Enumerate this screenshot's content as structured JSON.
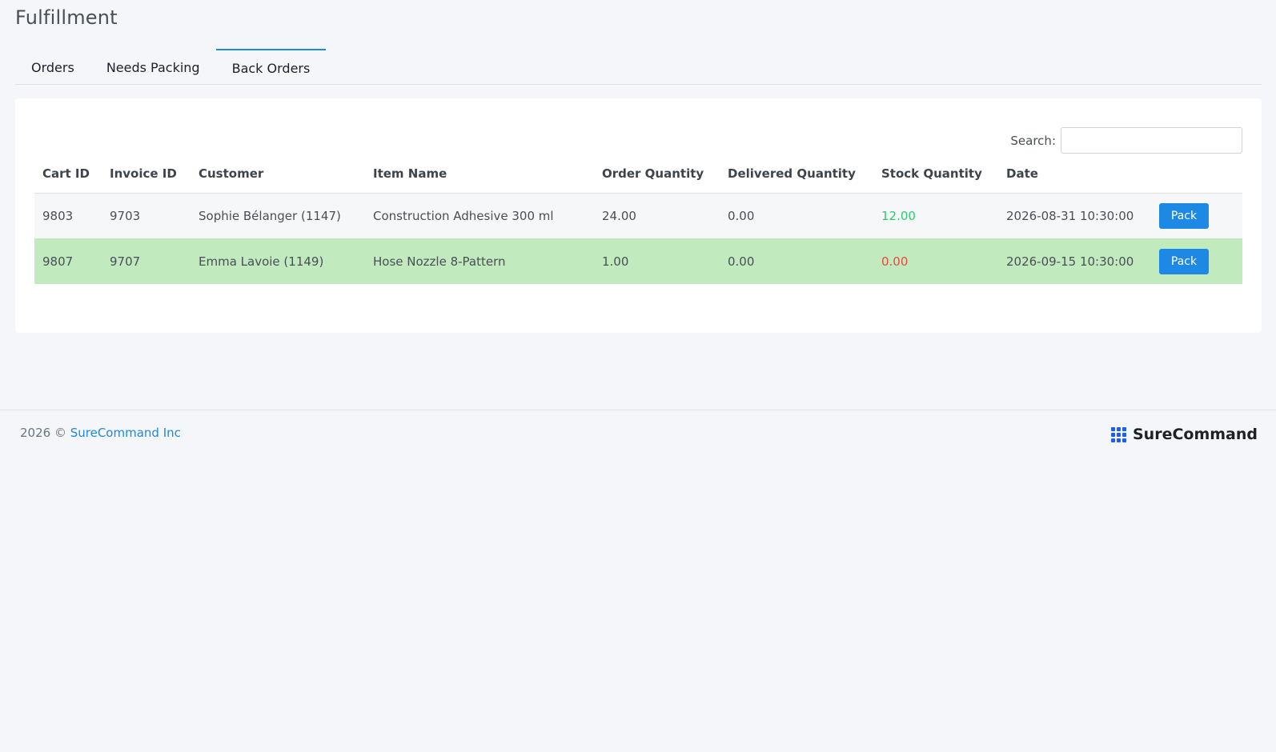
{
  "page": {
    "title": "Fulfillment"
  },
  "tabs": [
    {
      "label": "Orders",
      "active": false
    },
    {
      "label": "Needs Packing",
      "active": false
    },
    {
      "label": "Back Orders",
      "active": true
    }
  ],
  "search": {
    "label": "Search:",
    "value": "",
    "placeholder": ""
  },
  "table": {
    "headers": [
      "Cart ID",
      "Invoice ID",
      "Customer",
      "Item Name",
      "Order Quantity",
      "Delivered Quantity",
      "Stock Quantity",
      "Date",
      ""
    ],
    "rows": [
      {
        "cart_id": "9803",
        "invoice_id": "9703",
        "customer": "Sophie Bélanger (1147)",
        "item_name": "Construction Adhesive 300 ml",
        "order_qty": "24.00",
        "delivered_qty": "0.00",
        "stock_qty": "12.00",
        "date": "2026-08-31 10:30:00",
        "action": "Pack"
      },
      {
        "cart_id": "9807",
        "invoice_id": "9707",
        "customer": "Emma Lavoie (1149)",
        "item_name": "Hose Nozzle 8-Pattern",
        "order_qty": "1.00",
        "delivered_qty": "0.00",
        "stock_qty": "0.00",
        "date": "2026-09-15 10:30:00",
        "action": "Pack"
      }
    ]
  },
  "footer": {
    "copyright": "2026 ©",
    "company_link": "SureCommand Inc",
    "brand_name": "SureCommand",
    "brand_icon": "grid-logo-icon"
  },
  "colors": {
    "accent": "#1e88e5",
    "stock_ok": "#2ecc71",
    "stock_out": "#e74c3c",
    "highlight_row": "#c1ebbe"
  }
}
